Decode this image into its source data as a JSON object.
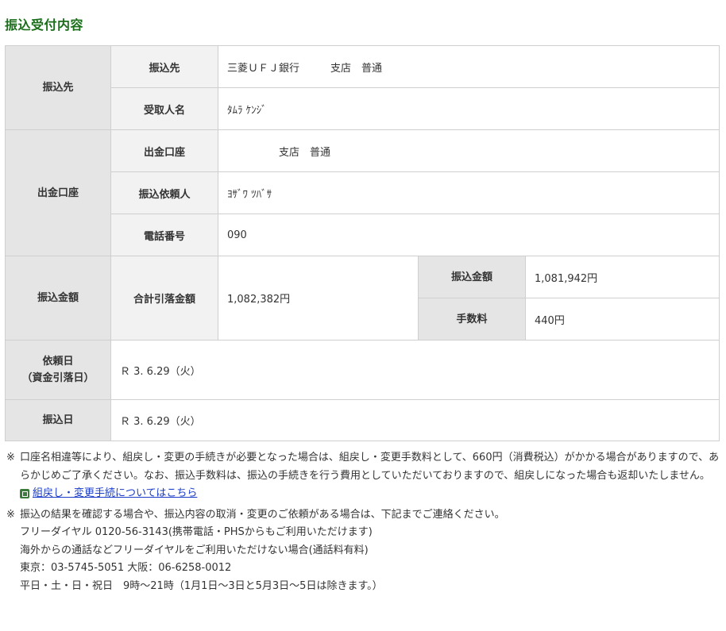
{
  "page_title": "振込受付内容",
  "sections": {
    "payee": {
      "label": "振込先",
      "rows": [
        {
          "label": "振込先",
          "value": "三菱ＵＦＪ銀行　　　支店　普通"
        },
        {
          "label": "受取人名",
          "value": "ﾀﾑﾗ ｹﾝｼﾞ"
        }
      ]
    },
    "source": {
      "label": "出金口座",
      "rows": [
        {
          "label": "出金口座",
          "value": "　　　　　支店　普通"
        },
        {
          "label": "振込依頼人",
          "value": "ﾖｻﾞﾜ ﾂﾊﾞｻ"
        },
        {
          "label": "電話番号",
          "value": "090"
        }
      ]
    },
    "amount": {
      "label": "振込金額",
      "total_label": "合計引落金額",
      "total_value": "1,082,382円",
      "transfer_label": "振込金額",
      "transfer_value": "1,081,942円",
      "fee_label": "手数料",
      "fee_value": "440円"
    },
    "request_date": {
      "label_line1": "依頼日",
      "label_line2": "（資金引落日）",
      "value": "Ｒ 3. 6.29（火）"
    },
    "transfer_date": {
      "label": "振込日",
      "value": "Ｒ 3. 6.29（火）"
    }
  },
  "notes": {
    "mark": "※",
    "note1": "口座名相違等により、組戻し・変更の手続きが必要となった場合は、組戻し・変更手数料として、660円（消費税込）がかかる場合がありますので、あらかじめご了承ください。なお、振込手数料は、振込の手続きを行う費用としていただいておりますので、組戻しになった場合も返却いたしません。",
    "link_text": "組戻し・変更手続についてはこちら",
    "note2_lines": [
      "振込の結果を確認する場合や、振込内容の取消・変更のご依頼がある場合は、下記までご連絡ください。",
      "フリーダイヤル 0120-56-3143(携帯電話・PHSからもご利用いただけます)",
      "海外からの通話などフリーダイヤルをご利用いただけない場合(通話料有料)",
      "東京：03-5745-5051 大阪：06-6258-0012",
      "平日・土・日・祝日　9時〜21時（1月1日〜3日と5月3日〜5日は除きます。）"
    ]
  },
  "colors": {
    "title": "#1a6e1a",
    "header_dark": "#e5e5e5",
    "header_light": "#f2f2f2",
    "border": "#cfcfcf",
    "link": "#1a3cc8"
  }
}
